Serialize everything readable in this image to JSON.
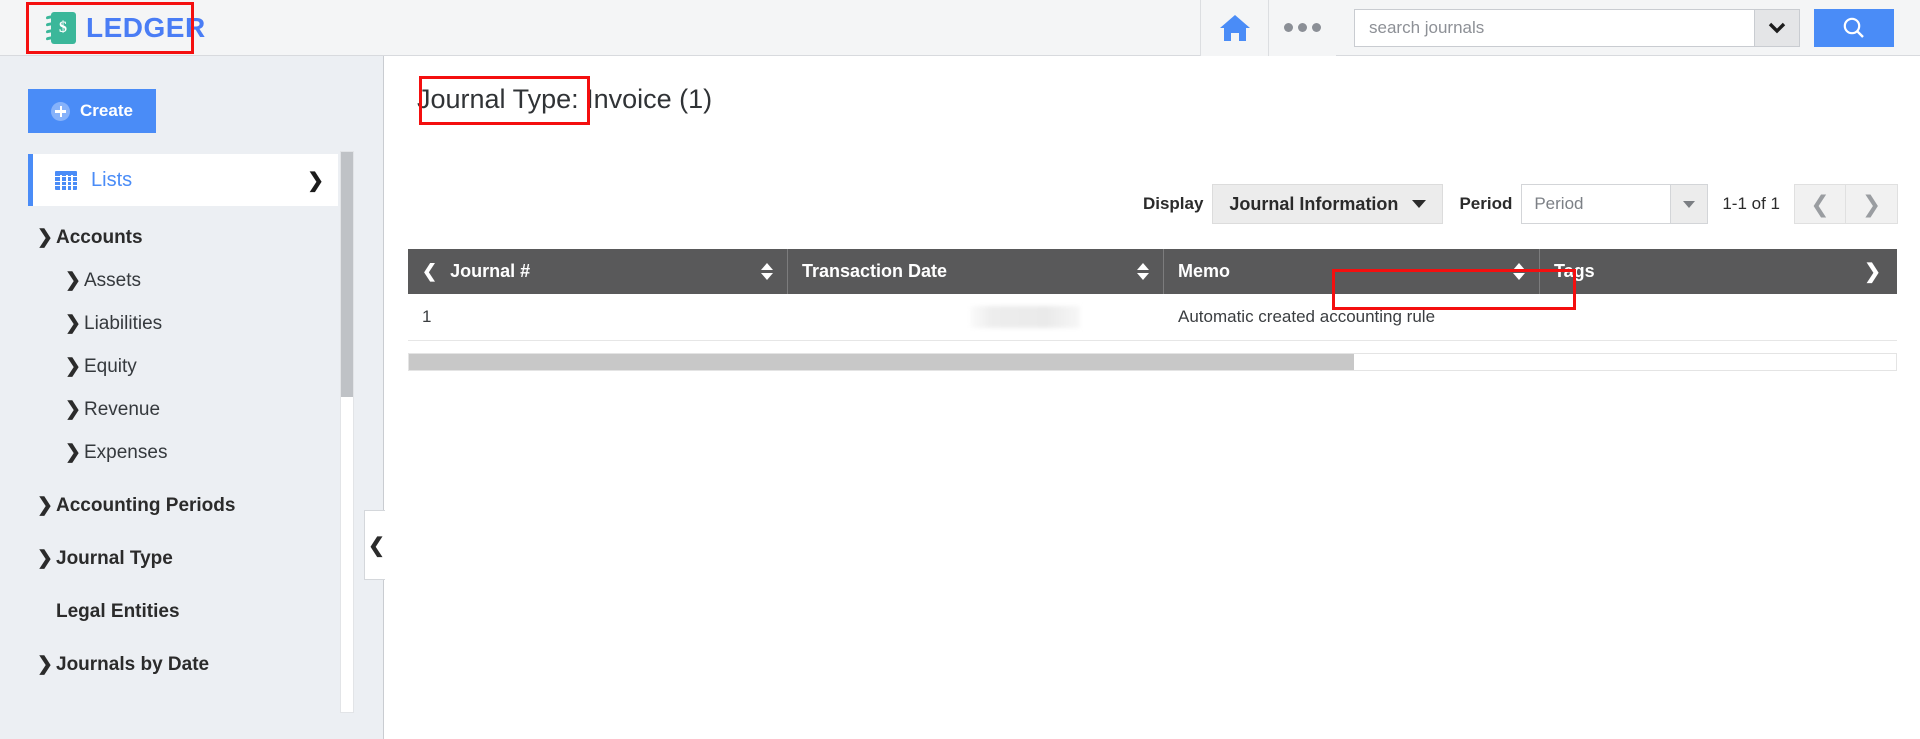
{
  "brand": {
    "name": "LEDGER",
    "logo_icon": "ledger-book-dollar-icon",
    "accent_color": "#4a8cf7",
    "logo_color": "#3bb79a"
  },
  "topbar": {
    "home_icon": "home-icon",
    "more_icon": "more-dots-icon",
    "search": {
      "placeholder": "search journals",
      "value": "",
      "dropdown_icon": "chevron-down-icon",
      "button_icon": "search-icon"
    }
  },
  "sidebar": {
    "create_label": "Create",
    "create_icon": "plus-circle-icon",
    "lists": {
      "label": "Lists",
      "icon": "grid-icon",
      "chevron": "chevron-down-icon"
    },
    "items": [
      {
        "label": "Accounts",
        "level": 0,
        "chevron": "down",
        "has_chevron": true
      },
      {
        "label": "Assets",
        "level": 1,
        "chevron": "right",
        "has_chevron": true
      },
      {
        "label": "Liabilities",
        "level": 1,
        "chevron": "right",
        "has_chevron": true
      },
      {
        "label": "Equity",
        "level": 1,
        "chevron": "right",
        "has_chevron": true
      },
      {
        "label": "Revenue",
        "level": 1,
        "chevron": "right",
        "has_chevron": true
      },
      {
        "label": "Expenses",
        "level": 1,
        "chevron": "right",
        "has_chevron": true
      },
      {
        "label": "Accounting Periods",
        "level": 0,
        "chevron": "right",
        "has_chevron": true
      },
      {
        "label": "Journal Type",
        "level": 0,
        "chevron": "right",
        "has_chevron": true
      },
      {
        "label": "Legal Entities",
        "level": 0,
        "chevron": "",
        "has_chevron": false
      },
      {
        "label": "Journals by Date",
        "level": 0,
        "chevron": "right",
        "has_chevron": true
      }
    ],
    "collapse_icon": "chevron-left-icon",
    "scrollbar": "vertical-scrollbar"
  },
  "main": {
    "title_prefix": "Journal Type",
    "title_suffix": ": Invoice (1)",
    "toolbar": {
      "display_label": "Display",
      "display_value": "Journal Information",
      "display_caret": "caret-down-icon",
      "period_label": "Period",
      "period_placeholder": "Period",
      "period_value": "",
      "period_caret": "caret-down-icon",
      "pager_count": "1-1 of 1",
      "prev_icon": "chevron-left-icon",
      "next_icon": "chevron-right-icon"
    },
    "table": {
      "leading_icon": "chevron-left-icon",
      "trailing_icon": "chevron-right-icon",
      "sort_icon": "sort-updown-icon",
      "columns": [
        "Journal #",
        "Transaction Date",
        "Memo",
        "Tags"
      ],
      "rows": [
        {
          "journal": "1",
          "transaction_date": "",
          "memo": "Automatic created accounting rule",
          "tags": ""
        }
      ],
      "horizontal_scrollbar": "horizontal-scrollbar"
    }
  },
  "annotations": {
    "color": "#f40f0f",
    "boxes": [
      "logo",
      "journal-type-title",
      "memo-cell"
    ]
  }
}
